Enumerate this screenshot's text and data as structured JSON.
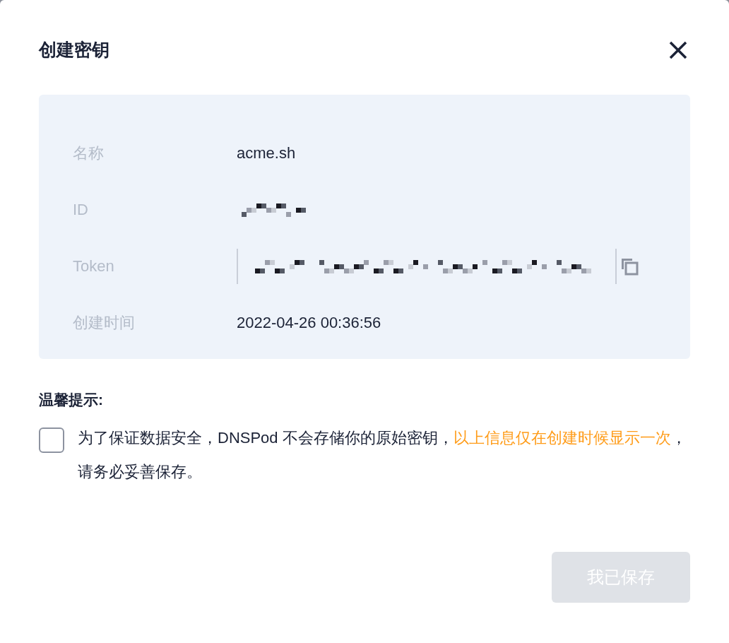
{
  "dialog": {
    "title": "创建密钥"
  },
  "fields": [
    {
      "label": "名称",
      "kind": "text",
      "value": "acme.sh"
    },
    {
      "label": "ID",
      "kind": "pixelated"
    },
    {
      "label": "Token",
      "kind": "pixelated-copy"
    },
    {
      "label": "创建时间",
      "kind": "text",
      "value": "2022-04-26 00:36:56"
    }
  ],
  "notice": {
    "title": "温馨提示:",
    "checked": false,
    "parts": [
      {
        "text": "为了保证数据安全，DNSPod 不会存储你的原始密钥，",
        "highlight": false
      },
      {
        "text": "以上信息仅在创建时候显示一次",
        "highlight": true
      },
      {
        "text": "，请务必妥善保存。",
        "highlight": false
      }
    ]
  },
  "confirm_button": {
    "label": "我已保存",
    "disabled": true
  }
}
